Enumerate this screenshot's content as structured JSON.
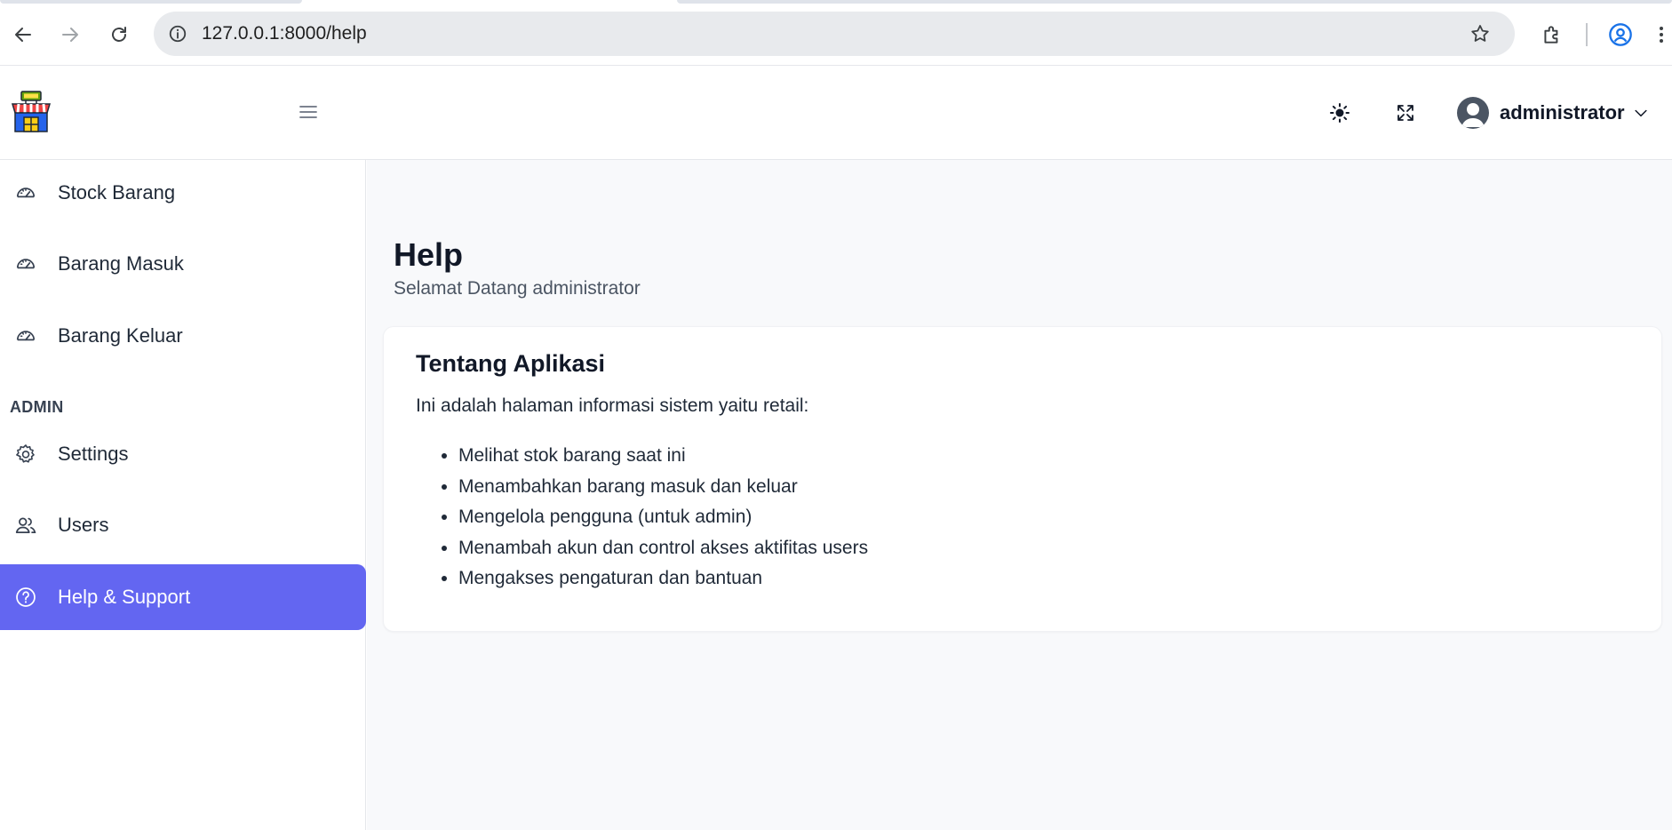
{
  "browser": {
    "url": "127.0.0.1:8000/help"
  },
  "header": {
    "user_name": "administrator"
  },
  "sidebar": {
    "items": [
      {
        "label": "Stock Barang",
        "icon": "gauge-icon"
      },
      {
        "label": "Barang Masuk",
        "icon": "gauge-icon"
      },
      {
        "label": "Barang Keluar",
        "icon": "gauge-icon"
      }
    ],
    "section_label": "ADMIN",
    "admin_items": [
      {
        "label": "Settings",
        "icon": "gear-icon"
      },
      {
        "label": "Users",
        "icon": "users-icon"
      },
      {
        "label": "Help & Support",
        "icon": "help-circle-icon",
        "active": true
      }
    ]
  },
  "main": {
    "title": "Help",
    "subtitle": "Selamat Datang administrator",
    "card": {
      "title": "Tentang Aplikasi",
      "description": "Ini adalah halaman informasi sistem yaitu retail:",
      "features": [
        "Melihat stok barang saat ini",
        "Menambahkan barang masuk dan keluar",
        "Mengelola pengguna (untuk admin)",
        "Menambah akun dan control akses aktifitas users",
        "Mengakses pengaturan dan bantuan"
      ]
    }
  },
  "colors": {
    "accent": "#6366f1",
    "main_bg": "#f8f9fb"
  }
}
